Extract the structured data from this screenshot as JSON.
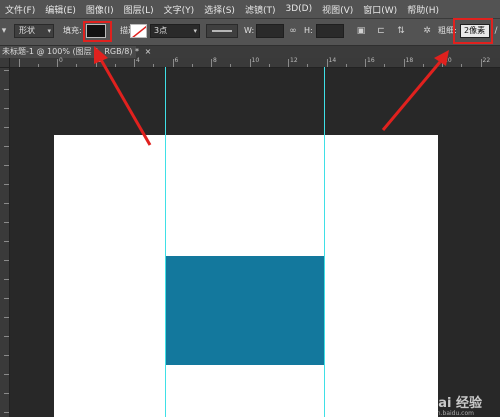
{
  "menubar": {
    "items": [
      "文件(F)",
      "编辑(E)",
      "图像(I)",
      "图层(L)",
      "文字(Y)",
      "选择(S)",
      "滤镜(T)",
      "3D(D)",
      "视图(V)",
      "窗口(W)",
      "帮助(H)"
    ]
  },
  "options": {
    "mode_value": "形状",
    "fill_label": "填充:",
    "stroke_label": "描边:",
    "stroke_width_value": "3点",
    "w_label": "W:",
    "h_label": "H:",
    "weight_label": "粗细:",
    "weight_value": "2像素"
  },
  "document": {
    "tab_title": "未标题-1 @ 100% (图层 1, RGB/8) *",
    "close_glyph": "×"
  },
  "ruler": {
    "labels": [
      "0",
      "2",
      "4",
      "6",
      "8",
      "10",
      "12",
      "14",
      "16",
      "18",
      "20",
      "22"
    ]
  },
  "colors": {
    "rect_fill": "#13789d",
    "guide": "#3fe0e6",
    "highlight": "#e0211e"
  },
  "watermark": {
    "text": "Bai 经验",
    "sub": "jingyan.baidu.com"
  }
}
